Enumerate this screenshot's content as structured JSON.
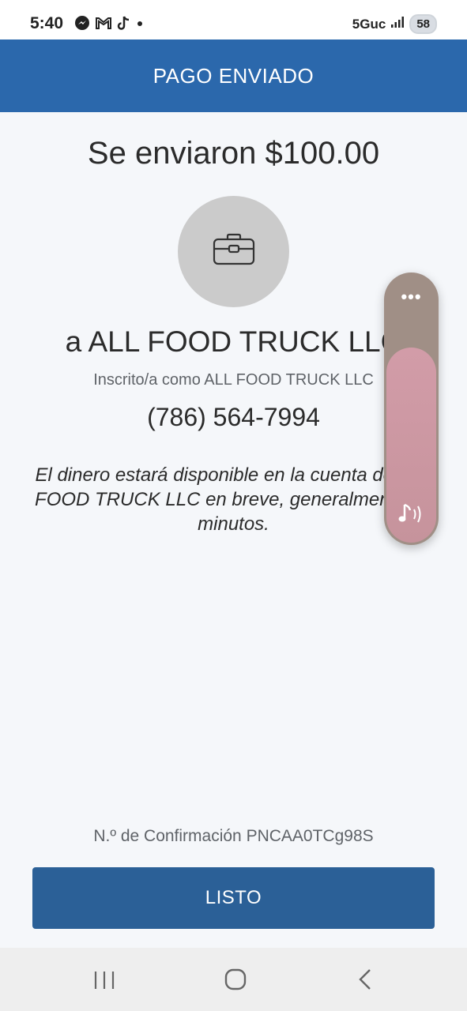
{
  "status_bar": {
    "time": "5:40",
    "network": "5Guc",
    "battery": "58",
    "left_icons": [
      "messenger-icon",
      "gmail-icon",
      "tiktok-icon",
      "dot-icon"
    ]
  },
  "header": {
    "title": "PAGO ENVIADO",
    "color": "#2b68ac"
  },
  "payment": {
    "amount_text": "Se enviaron $100.00",
    "recipient": "a ALL FOOD TRUCK LLC",
    "registered_as": "Inscrito/a como ALL FOOD TRUCK LLC",
    "phone": "(786) 564-7994",
    "notice": "El dinero estará disponible en la cuenta de ALL FOOD TRUCK LLC en breve, generalmente en minutos.",
    "avatar_icon": "briefcase-icon"
  },
  "footer": {
    "confirmation": "N.º de Confirmación PNCAA0TCg98S",
    "done_label": "LISTO",
    "button_color": "#2b6097"
  },
  "volume_overlay": {
    "more_label": "•••",
    "level": 0.73,
    "icon": "music-volume-icon"
  },
  "nav": {
    "recent": "recent-apps-icon",
    "home": "home-icon",
    "back": "back-icon"
  }
}
